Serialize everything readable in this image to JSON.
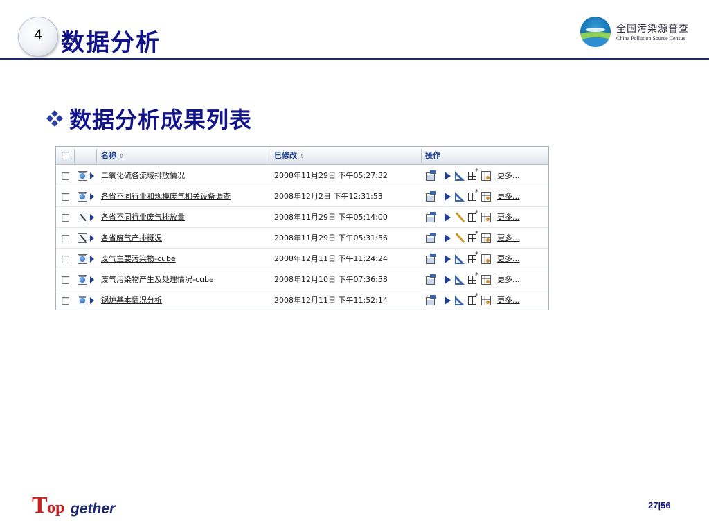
{
  "header": {
    "section_number": "4",
    "title": "数据分析",
    "logo": {
      "name_cn": "全国污染源普查",
      "name_en": "China Pollution Source Census"
    }
  },
  "subheading": "数据分析成果列表",
  "table": {
    "columns": {
      "name": "名称",
      "modified": "已修改",
      "actions": "操作"
    },
    "more_label": "更多...",
    "rows": [
      {
        "name": "二氧化硫各流域排放情况",
        "modified": "2008年11月29日 下午05:27:32",
        "type": "report"
      },
      {
        "name": "各省不同行业和规模废气相关设备调查",
        "modified": "2008年12月2日 下午12:31:53",
        "type": "report"
      },
      {
        "name": "各省不同行业废气排放量",
        "modified": "2008年11月29日 下午05:14:00",
        "type": "edit"
      },
      {
        "name": "各省废气产排概况",
        "modified": "2008年11月29日 下午05:31:56",
        "type": "edit"
      },
      {
        "name": "废气主要污染物-cube",
        "modified": "2008年12月11日 下午11:24:24",
        "type": "report"
      },
      {
        "name": "废气污染物产生及处理情况-cube",
        "modified": "2008年12月10日 下午07:36:58",
        "type": "report"
      },
      {
        "name": "锅炉基本情况分析",
        "modified": "2008年12月11日 下午11:52:14",
        "type": "report"
      }
    ]
  },
  "footer": {
    "brand": {
      "t": "T",
      "op": "op",
      "gether": "gether"
    },
    "page": "27|56"
  },
  "colors": {
    "title": "#14148a",
    "rule": "#1d2a6e",
    "brand_red": "#c82020",
    "header_link": "#1a3f8a"
  },
  "icons": [
    "section-badge-icon",
    "census-logo-icon",
    "diamond-bullet-icon",
    "checkbox-icon",
    "report-type-icon",
    "edit-type-icon",
    "expand-arrow-icon",
    "properties-icon",
    "run-icon",
    "design-icon",
    "grid-add-icon",
    "schedule-icon"
  ]
}
